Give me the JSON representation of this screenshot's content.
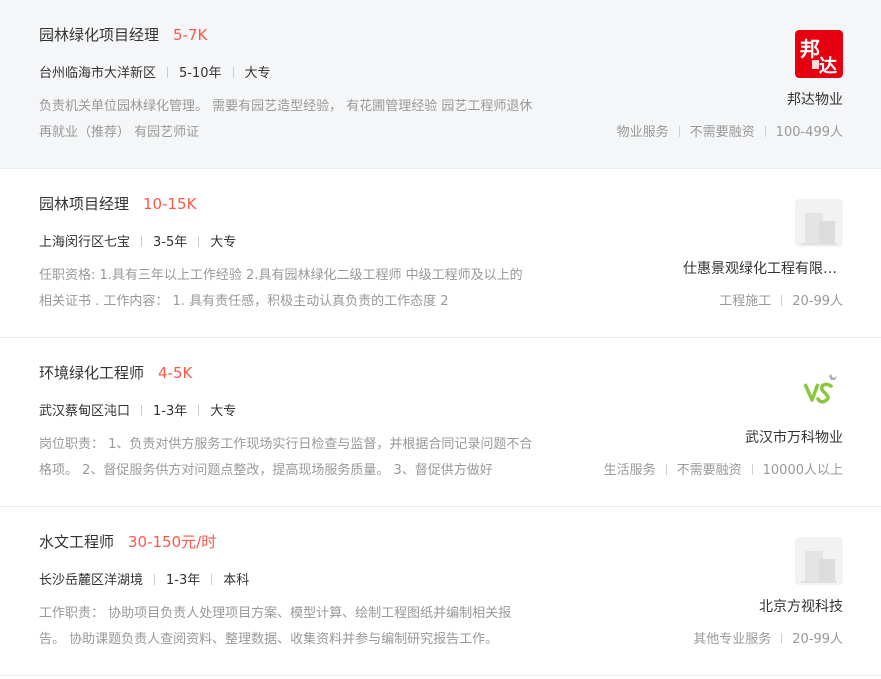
{
  "jobs": [
    {
      "title": "园林绿化项目经理",
      "salary": "5-7K",
      "location": "台州临海市大洋新区",
      "experience": "5-10年",
      "education": "大专",
      "description": "负责机关单位园林绿化管理。 需要有园艺造型经验， 有花圃管理经验 园艺工程师退休再就业（推荐） 有园艺师证",
      "company": "邦达物业",
      "logo": {
        "type": "banda",
        "text": "邦达",
        "bg": "#e60012"
      },
      "tags": [
        "物业服务",
        "不需要融资",
        "100-499人"
      ]
    },
    {
      "title": "园林项目经理",
      "salary": "10-15K",
      "location": "上海闵行区七宝",
      "experience": "3-5年",
      "education": "大专",
      "description": "任职资格: 1.具有三年以上工作经验 2.具有园林绿化二级工程师 中级工程师及以上的相关证书 . 工作内容： 1. 具有责任感，积极主动认真负责的工作态度 2",
      "company": "仕惠景观绿化工程有限公司",
      "logo": {
        "type": "placeholder"
      },
      "tags": [
        "工程施工",
        "20-99人"
      ]
    },
    {
      "title": "环境绿化工程师",
      "salary": "4-5K",
      "location": "武汉蔡甸区沌口",
      "experience": "1-3年",
      "education": "大专",
      "description": "岗位职责： 1、负责对供方服务工作现场实行日检查与监督，并根据合同记录问题不合格项。 2、督促服务供方对问题点整改，提高现场服务质量。 3、督促供方做好",
      "company": "武汉市万科物业",
      "logo": {
        "type": "vanke",
        "color": "#8cc63f"
      },
      "tags": [
        "生活服务",
        "不需要融资",
        "10000人以上"
      ]
    },
    {
      "title": "水文工程师",
      "salary": "30-150元/时",
      "location": "长沙岳麓区洋湖境",
      "experience": "1-3年",
      "education": "本科",
      "description": "工作职责： 协助项目负责人处理项目方案、模型计算、绘制工程图纸并编制相关报告。 协助课题负责人查阅资料、整理数据、收集资料并参与编制研究报告工作。",
      "company": "北京方视科技",
      "logo": {
        "type": "placeholder"
      },
      "tags": [
        "其他专业服务",
        "20-99人"
      ]
    }
  ]
}
